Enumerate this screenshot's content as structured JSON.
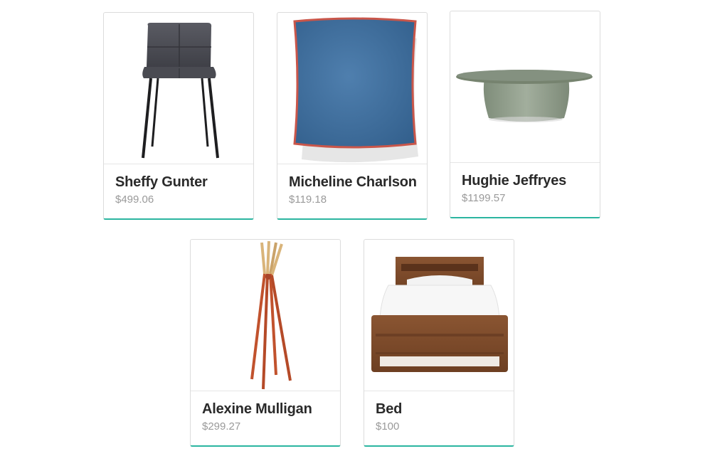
{
  "products": [
    {
      "name": "Sheffy Gunter",
      "price": "$499.06",
      "image": "dining-chair"
    },
    {
      "name": "Micheline Charlson",
      "price": "$119.18",
      "image": "throw-pillow"
    },
    {
      "name": "Hughie Jeffryes",
      "price": "$1199.57",
      "image": "coffee-table"
    },
    {
      "name": "Alexine Mulligan",
      "price": "$299.27",
      "image": "coat-rack"
    },
    {
      "name": "Bed",
      "price": "$100",
      "image": "bed"
    }
  ],
  "colors": {
    "accent_border": "#2bb5a0",
    "name_text": "#2a2a2a",
    "price_text": "#9a9a9a"
  }
}
